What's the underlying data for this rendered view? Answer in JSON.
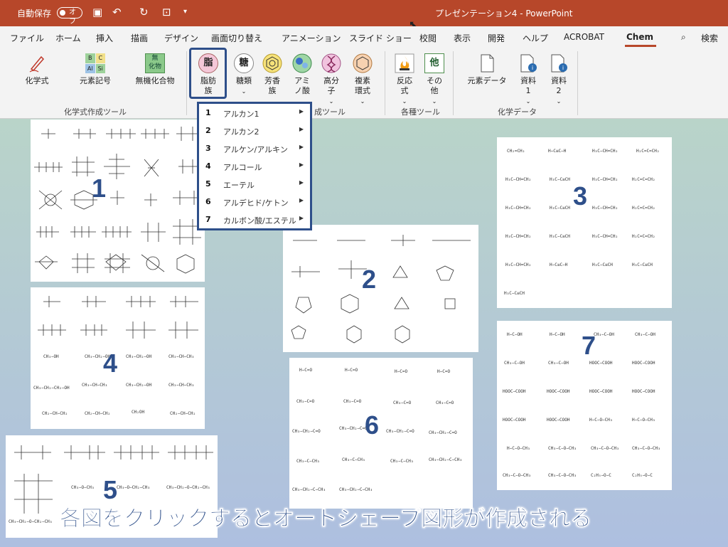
{
  "titlebar": {
    "autosave_label": "自動保存",
    "autosave_state": "オフ",
    "doc_title": "プレゼンテーション4  -  PowerPoint"
  },
  "tabs": [
    {
      "label": "ファイル"
    },
    {
      "label": "ホーム"
    },
    {
      "label": "挿入"
    },
    {
      "label": "描画"
    },
    {
      "label": "デザイン"
    },
    {
      "label": "画面切り替え"
    },
    {
      "label": "アニメーション"
    },
    {
      "label": "スライド ショー"
    },
    {
      "label": "校閲"
    },
    {
      "label": "表示"
    },
    {
      "label": "開発"
    },
    {
      "label": "ヘルプ"
    },
    {
      "label": "ACROBAT"
    },
    {
      "label": "Chem"
    }
  ],
  "search_label": "検索",
  "ribbon": {
    "buttons": {
      "formula": "化学式",
      "element_symbol": "元素記号",
      "inorganic": "無機化合物",
      "aliphatic": "脂肪族",
      "aliphatic_icon_char": "脂",
      "sugars": "糖類",
      "sugars_icon_char": "糖",
      "aromatic": "芳香族",
      "amino": "アミノ酸",
      "polymer": "高分子",
      "heterocycle": "複素環式",
      "reaction": "反応式",
      "other": "その他",
      "other_icon_char": "他",
      "element_data": "元素データ",
      "material1": "資料1",
      "material2": "資料2"
    },
    "element_symbol_icon": [
      "B",
      "C",
      "Al",
      "Si"
    ],
    "inorganic_icon": [
      "無",
      "化物"
    ],
    "groups": {
      "g1": "化学式作成ツール",
      "g2": "成ツール",
      "g3": "各種ツール",
      "g4": "化学データ"
    }
  },
  "menu": {
    "items": [
      {
        "num": "1",
        "label": "アルカン1"
      },
      {
        "num": "2",
        "label": "アルカン2"
      },
      {
        "num": "3",
        "label": "アルケン/アルキン"
      },
      {
        "num": "4",
        "label": "アルコール"
      },
      {
        "num": "5",
        "label": "エーテル"
      },
      {
        "num": "6",
        "label": "アルデヒド/ケトン"
      },
      {
        "num": "7",
        "label": "カルボン酸/エステル"
      }
    ]
  },
  "panels": {
    "p1": "1",
    "p2": "2",
    "p3": "3",
    "p4": "4",
    "p5": "5",
    "p6": "6",
    "p7": "7"
  },
  "molecules": {
    "m3": [
      "CH₃−CH₃",
      "CH₂=CH₂",
      "H₃C−CH=CH₂",
      "H−C≡C−H",
      "H₂C=C=CH₂",
      "H₃C−C≡CH"
    ],
    "m4": [
      "CH₃−OH",
      "CH₃−CH₂−OH",
      "CH₃−CH−CH₃",
      "CH₂OH",
      "CH₃−CH₂−CH₂−OH",
      "CH₂−CH−CH₂"
    ],
    "m5": [
      "CH₃−O−CH₃",
      "CH₃−O−CH₂−CH₃",
      "CH₃−CH₂−O−CH₂−CH₃",
      "CH₃−CH₂−O−CH₂−CH₃"
    ],
    "m6": [
      "H−C=O",
      "CH₃−C=O",
      "CH₃−CH₂−C=O",
      "CH₃−C−CH₃",
      "CH₃−CH₂−C−CH₃",
      "H−C=O"
    ],
    "m7": [
      "H−C−OH",
      "CH₃−C−OH",
      "HOOC−COOH",
      "H−C−O−CH₃",
      "CH₃−C−O−CH₃",
      "C₂H₅−O−C"
    ]
  },
  "caption": "各図をクリックするとオートシェープ図形が作成される"
}
